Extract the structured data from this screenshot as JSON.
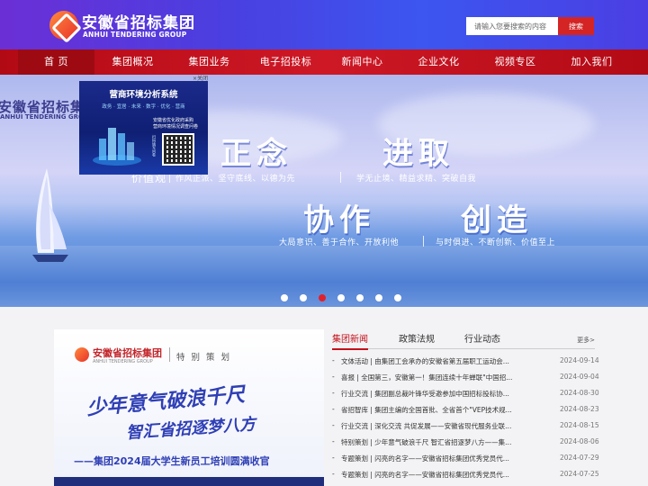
{
  "header": {
    "logo_cn": "安徽省招标集团",
    "logo_en": "ANHUI TENDERING GROUP",
    "search": {
      "placeholder": "请输入您要搜索的内容",
      "button_label": "搜索"
    }
  },
  "nav": {
    "items": [
      {
        "label": "首 页",
        "active": true
      },
      {
        "label": "集团概况"
      },
      {
        "label": "集团业务"
      },
      {
        "label": "电子招投标"
      },
      {
        "label": "新闻中心"
      },
      {
        "label": "企业文化"
      },
      {
        "label": "视频专区"
      },
      {
        "label": "加入我们"
      }
    ]
  },
  "banner": {
    "logo_cn": "安徽省招标集团",
    "logo_en": "ANHUI TENDERING GROUP",
    "value_title": "价值观",
    "values": [
      {
        "word": "正念",
        "desc": "作风正派、坚守底线、以德为先"
      },
      {
        "word": "进取",
        "desc": "学无止境、精益求精、突破自我"
      },
      {
        "word": "协作",
        "desc": "大局意识、善于合作、开放利他"
      },
      {
        "word": "创造",
        "desc": "与时俱进、不断创新、价值至上"
      }
    ],
    "slide_count": 7,
    "active_slide": 2
  },
  "popup": {
    "close_label": "×关闭",
    "title": "营商环境分析系统",
    "subtitle": "政务 · 宜居 · 未来 · 数字 · 优化 · 营商",
    "note_line1": "安徽省优化政府采购",
    "note_line2": "营商环境情况调查问卷",
    "qr_caption": "扫码填写问卷"
  },
  "promo": {
    "logo_cn": "安徽省招标集团",
    "logo_en": "ANHUI TENDERING GROUP",
    "tag": "特别策划",
    "slogan_line1": "少年意气破浪千尺",
    "slogan_line2": "智汇省招逐梦八方",
    "caption": "——集团2024届大学生新员工培训圆满收官"
  },
  "news": {
    "tabs": [
      {
        "label": "集团新闻",
        "active": true
      },
      {
        "label": "政策法规"
      },
      {
        "label": "行业动态"
      }
    ],
    "more_label": "更多>",
    "items": [
      {
        "title": "文体活动 | 由集团工会承办的安徽省第五届职工运动会...",
        "date": "2024-09-14"
      },
      {
        "title": "喜报 | 全国第三，安徽第一！集团连续十年蝉联\"中国招...",
        "date": "2024-09-04"
      },
      {
        "title": "行业交流 | 集团副总裁叶锋华受邀参加中国招标投标协...",
        "date": "2024-08-30"
      },
      {
        "title": "省招智库 | 集团主编的全国首批、全省首个\"VEP技术规...",
        "date": "2024-08-23"
      },
      {
        "title": "行业交流 | 深化交流 共促发展——安徽省现代服务业联...",
        "date": "2024-08-15"
      },
      {
        "title": "特别策划 | 少年意气破浪千尺 智汇省招逐梦八方——集...",
        "date": "2024-08-06"
      },
      {
        "title": "专题策划 | 闪亮的名字——安徽省招标集团优秀党员代...",
        "date": "2024-07-29"
      },
      {
        "title": "专题策划 | 闪亮的名字——安徽省招标集团优秀党员代...",
        "date": "2024-07-25"
      }
    ]
  }
}
